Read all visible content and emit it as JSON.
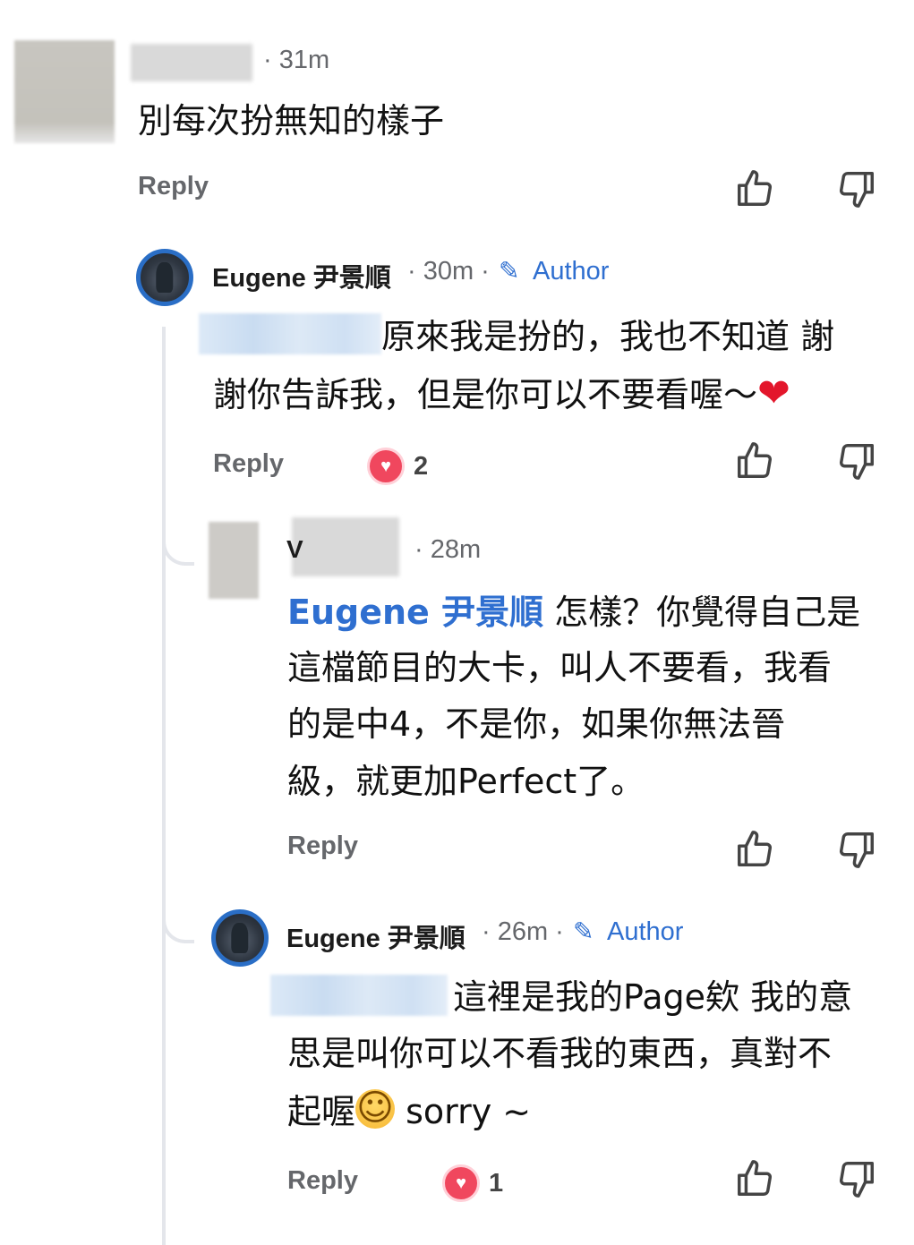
{
  "comments": [
    {
      "id": "c1",
      "time": "· 31m",
      "text": "別每次扮無知的樣子",
      "reply_label": "Reply"
    },
    {
      "id": "c2",
      "author": "Eugene 尹景順",
      "time": "· 30m ·",
      "badge": "Author",
      "text_line1": "原來我是扮的，我也不知道 謝",
      "text_line2": "謝你告訴我，但是你可以不要看喔～",
      "reply_label": "Reply",
      "reaction_count": "2"
    },
    {
      "id": "c3",
      "name_fragment_start": "V",
      "time": "· 28m",
      "mention": "Eugene 尹景順",
      "text_line1_rest": " 怎樣？你覺得自己是",
      "text_line2": "這檔節目的大卡，叫人不要看，我看",
      "text_line3": "的是中4，不是你，如果你無法晉",
      "text_line4": "級，就更加Perfect了。",
      "reply_label": "Reply"
    },
    {
      "id": "c4",
      "author": "Eugene 尹景順",
      "time": "· 26m ·",
      "badge": "Author",
      "text_line1": "這裡是我的Page欸 我的意",
      "text_line2": "思是叫你可以不看我的東西，真對不",
      "text_line3_a": "起喔",
      "text_line3_b": " sorry ~",
      "reply_label": "Reply",
      "reaction_count": "1"
    }
  ],
  "icons": {
    "like": "thumbs-up-icon",
    "dislike": "thumbs-down-icon",
    "heart": "heart-reaction-icon",
    "pencil": "pencil-icon"
  },
  "colors": {
    "accent": "#2f6fd0",
    "heart": "#f0475e",
    "muted": "#65676b"
  }
}
